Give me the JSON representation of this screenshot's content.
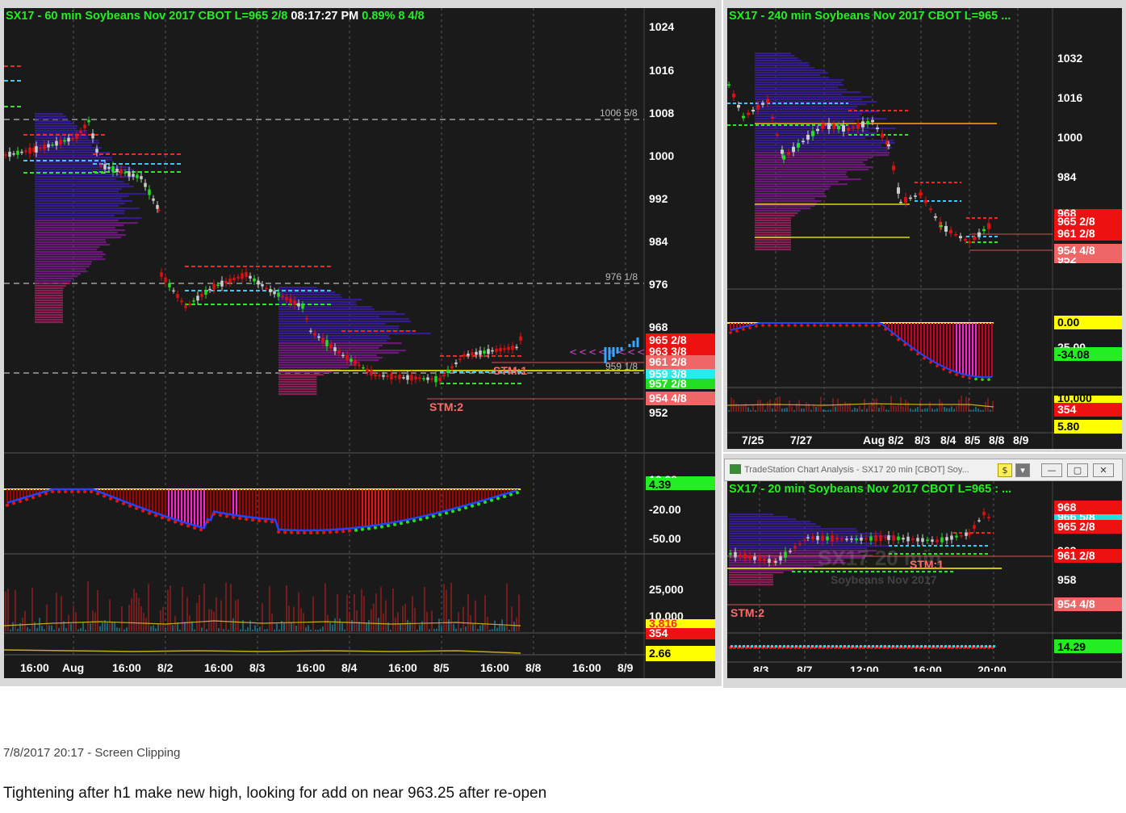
{
  "main": {
    "title_prefix": "SX17 - 60 min  Soybeans Nov 2017  CBOT  L=965 2/8",
    "title_time": "08:17:27 PM",
    "title_suffix": "0.89%  8 4/8",
    "price_axis": [
      "1024",
      "1016",
      "1008",
      "1000",
      "992",
      "984",
      "976",
      "968",
      "952"
    ],
    "level_labels": [
      "1006 5/8",
      "976 1/8",
      "959 1/8"
    ],
    "tags": [
      "965 2/8",
      "963 3/8",
      "961 2/8",
      "959 3/8",
      "957 2/8",
      "954 4/8"
    ],
    "stm1": "STM:1",
    "stm2": "STM:2",
    "osc_axis": [
      "10.00",
      "-20.00",
      "-50.00"
    ],
    "osc_tag": "4.39",
    "vol_axis": [
      "25,000",
      "10,000"
    ],
    "vol_tags": [
      "3,816",
      "354"
    ],
    "atr_tag": "2.66",
    "time_axis": [
      "16:00",
      "Aug",
      "16:00",
      "8/2",
      "16:00",
      "8/3",
      "16:00",
      "8/4",
      "16:00",
      "8/5",
      "16:00",
      "8/8",
      "16:00",
      "8/9"
    ]
  },
  "h4": {
    "title": "SX17 - 240 min  Soybeans Nov 2017  CBOT  L=965 ...",
    "price_axis": [
      "1032",
      "1016",
      "1000",
      "984"
    ],
    "tags": [
      "968",
      "965 2/8",
      "961 2/8",
      "954 4/8",
      "952"
    ],
    "osc_tags": [
      "0.00",
      "25.00",
      "-34.08"
    ],
    "vol_tags": [
      "10,000",
      "354",
      "5.80"
    ],
    "time_axis": [
      "7/25",
      "7/27",
      "Aug 8/2",
      "8/3",
      "8/4",
      "8/5",
      "8/8",
      "8/9"
    ]
  },
  "m20": {
    "window_title": "TradeStation Chart Analysis - SX17 20 min [CBOT] Soy...",
    "title": "SX17 - 20 min  Soybeans Nov 2017  CBOT  L=965 : ...",
    "watermark": "SX17 20 min",
    "watermark_sub": "Soybeans Nov 2017",
    "price_axis": [
      "958"
    ],
    "tags": [
      "968",
      "966 5/8",
      "965 2/8",
      "963",
      "961 2/8",
      "954 4/8"
    ],
    "stm1": "STM:1",
    "stm2": "STM:2",
    "osc_tag": "14.29",
    "time_axis": [
      "8/3",
      "8/7",
      "12:00",
      "16:00",
      "20:00"
    ]
  },
  "caption": "7/8/2017 20:17 - Screen Clipping",
  "note": "Tightening after h1 make new high, looking for add on near 963.25 after re-open",
  "colors": {
    "bull": "#22dd22",
    "bear": "#dd1111",
    "up": "#cccccc",
    "accent": "#ffff00"
  }
}
